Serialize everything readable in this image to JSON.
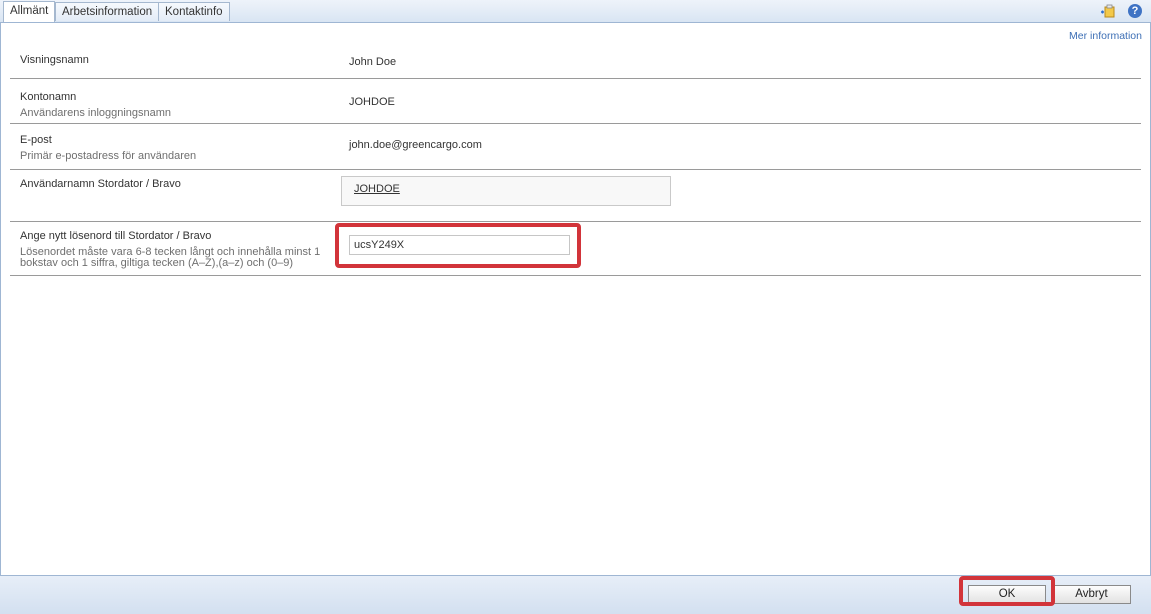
{
  "tabs": [
    {
      "label": "Allmänt"
    },
    {
      "label": "Arbetsinformation"
    },
    {
      "label": "Kontaktinfo"
    }
  ],
  "more_info_link": "Mer information",
  "fields": {
    "display_name": {
      "label": "Visningsnamn",
      "value": "John Doe"
    },
    "account_name": {
      "label": "Kontonamn",
      "description": "Användarens inloggningsnamn",
      "value": "JOHDOE"
    },
    "email": {
      "label": "E-post",
      "description": "Primär e-postadress för användaren",
      "value": "john.doe@greencargo.com"
    },
    "mainframe_username": {
      "label": "Användarnamn Stordator / Bravo",
      "value": "JOHDOE"
    },
    "new_password": {
      "label": "Ange nytt lösenord till Stordator / Bravo",
      "description_line1": "Lösenordet måste vara 6-8 tecken långt och innehålla minst 1",
      "description_line2": "bokstav och 1 siffra, giltiga tecken (A–Z),(a–z) och (0–9)",
      "value": "ucsY249X"
    }
  },
  "buttons": {
    "ok": "OK",
    "cancel": "Avbryt"
  },
  "icons": {
    "toolbar": "add-item-icon",
    "help": "help-icon"
  },
  "colors": {
    "highlight": "#d2343a",
    "link": "#3d6fb5",
    "tab_bar": "#d9e5f3"
  }
}
